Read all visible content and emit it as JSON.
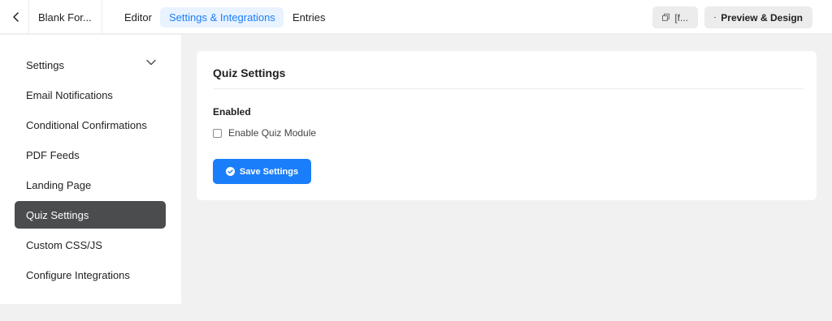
{
  "topbar": {
    "form_title": "Blank For...",
    "tabs": [
      {
        "label": "Editor"
      },
      {
        "label": "Settings & Integrations"
      },
      {
        "label": "Entries"
      }
    ],
    "shortcode_label": "[f...",
    "preview_label": "Preview & Design"
  },
  "sidebar": {
    "items": [
      {
        "label": "Settings"
      },
      {
        "label": "Email Notifications"
      },
      {
        "label": "Conditional Confirmations"
      },
      {
        "label": "PDF Feeds"
      },
      {
        "label": "Landing Page"
      },
      {
        "label": "Quiz Settings"
      },
      {
        "label": "Custom CSS/JS"
      },
      {
        "label": "Configure Integrations"
      }
    ]
  },
  "card": {
    "title": "Quiz Settings",
    "field_label": "Enabled",
    "checkbox_label": "Enable Quiz Module",
    "checkbox_checked": false,
    "save_label": "Save Settings"
  },
  "colors": {
    "accent": "#1a7efb",
    "active_tab_bg": "#e9f3ff",
    "sidebar_active_bg": "#4b4c4d"
  }
}
